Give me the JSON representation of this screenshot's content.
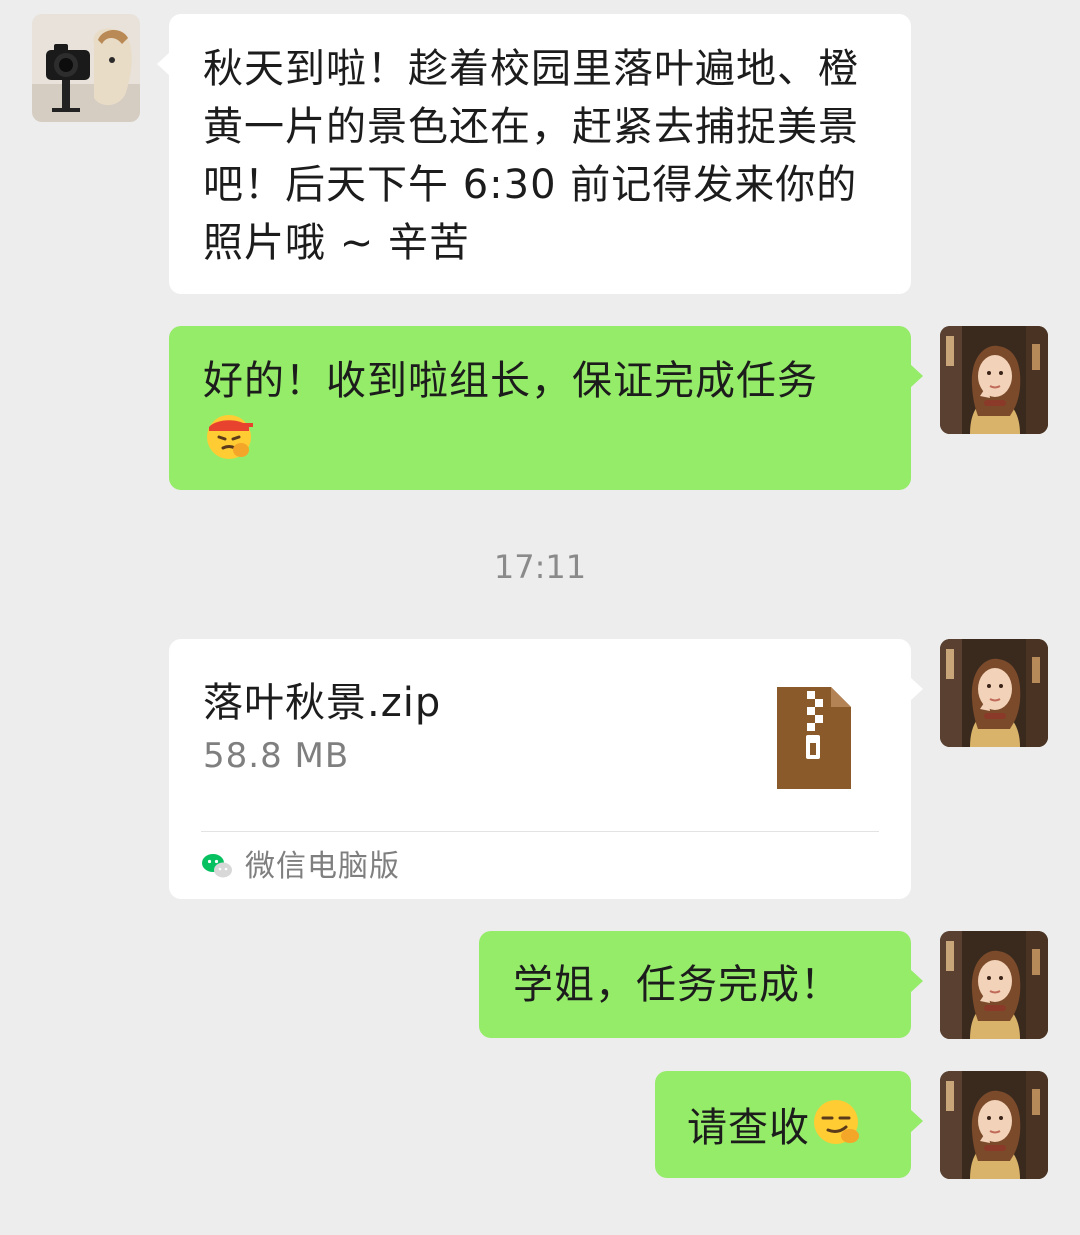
{
  "messages": {
    "m1": {
      "text": "秋天到啦！趁着校园里落叶遍地、橙黄一片的景色还在，赶紧去捕捉美景吧！后天下午 6:30 前记得发来你的照片哦 ~ 辛苦"
    },
    "m2": {
      "text": "好的！收到啦组长，保证完成任务",
      "emoji": "saluting-face-emoji"
    },
    "timestamp": "17:11",
    "file": {
      "name": "落叶秋景.zip",
      "size": "58.8 MB",
      "source": "微信电脑版",
      "icon": "zip-file-icon"
    },
    "m4": {
      "text": "学姐，任务完成！"
    },
    "m5": {
      "text": "请查收",
      "emoji": "smirking-face-emoji"
    }
  },
  "colors": {
    "background": "#ededed",
    "incoming_bubble": "#ffffff",
    "outgoing_bubble": "#95ec69",
    "zip_icon": "#8b5a2b",
    "wechat_green": "#07c160"
  },
  "avatars": {
    "contact": "cat-with-camera-avatar",
    "self": "girl-portrait-avatar"
  }
}
